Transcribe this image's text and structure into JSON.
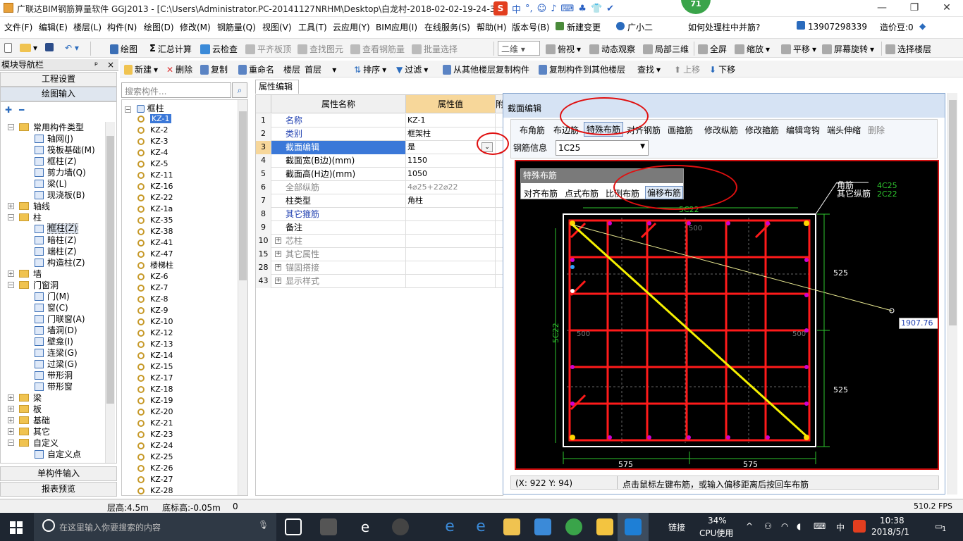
{
  "window": {
    "title": "广联达BIM钢筋算量软件 GGJ2013 - [C:\\Users\\Administrator.PC-20141127NRHM\\Desktop\\白龙村-2018-02-02-19-24-35",
    "ime_items": [
      "中",
      "°,",
      "☺",
      "♪",
      "⌨",
      "♣",
      "👕",
      "✔"
    ],
    "badge": "71",
    "controls": [
      "—",
      "❐",
      "✕"
    ]
  },
  "menu": {
    "items": [
      "文件(F)",
      "编辑(E)",
      "楼层(L)",
      "构件(N)",
      "绘图(D)",
      "修改(M)",
      "钢筋量(Q)",
      "视图(V)",
      "工具(T)",
      "云应用(Y)",
      "BIM应用(I)",
      "在线服务(S)",
      "帮助(H)",
      "版本号(B)",
      "新建变更",
      "广小二"
    ],
    "question": "如何处理柱中并筋?",
    "phone": "13907298339",
    "price_level": "造价豆:0"
  },
  "toolbar1": {
    "items": [
      "绘图",
      "汇总计算",
      "云检查",
      "平齐板顶",
      "查找图元",
      "查看钢筋量",
      "批量选择"
    ],
    "view_mode": "二维",
    "view_items": [
      "俯视",
      "动态观察",
      "局部三维",
      "全屏",
      "缩放",
      "平移",
      "屏幕旋转",
      "选择楼层"
    ]
  },
  "toolbar2": {
    "items": [
      "新建",
      "删除",
      "复制",
      "重命名",
      "楼层",
      "首层",
      "排序",
      "过滤",
      "从其他楼层复制构件",
      "复制构件到其他楼层",
      "查找",
      "上移",
      "下移"
    ]
  },
  "nav": {
    "header": "模块导航栏",
    "pin": "ᵖ",
    "close": "×",
    "buttons": [
      "工程设置",
      "绘图输入"
    ],
    "bottom_buttons": [
      "单构件输入",
      "报表预览"
    ],
    "tree": [
      {
        "label": "常用构件类型",
        "level": 0,
        "kind": "folder",
        "toggle": "−"
      },
      {
        "label": "轴网(J)",
        "level": 1,
        "kind": "item"
      },
      {
        "label": "筏板基础(M)",
        "level": 1,
        "kind": "item"
      },
      {
        "label": "框柱(Z)",
        "level": 1,
        "kind": "item"
      },
      {
        "label": "剪力墙(Q)",
        "level": 1,
        "kind": "item"
      },
      {
        "label": "梁(L)",
        "level": 1,
        "kind": "item"
      },
      {
        "label": "现浇板(B)",
        "level": 1,
        "kind": "item"
      },
      {
        "label": "轴线",
        "level": 0,
        "kind": "folder",
        "toggle": "+"
      },
      {
        "label": "柱",
        "level": 0,
        "kind": "folder",
        "toggle": "−"
      },
      {
        "label": "框柱(Z)",
        "level": 1,
        "kind": "item",
        "selected": true
      },
      {
        "label": "暗柱(Z)",
        "level": 1,
        "kind": "item"
      },
      {
        "label": "端柱(Z)",
        "level": 1,
        "kind": "item"
      },
      {
        "label": "构造柱(Z)",
        "level": 1,
        "kind": "item"
      },
      {
        "label": "墙",
        "level": 0,
        "kind": "folder",
        "toggle": "+"
      },
      {
        "label": "门窗洞",
        "level": 0,
        "kind": "folder",
        "toggle": "−"
      },
      {
        "label": "门(M)",
        "level": 1,
        "kind": "item"
      },
      {
        "label": "窗(C)",
        "level": 1,
        "kind": "item"
      },
      {
        "label": "门联窗(A)",
        "level": 1,
        "kind": "item"
      },
      {
        "label": "墙洞(D)",
        "level": 1,
        "kind": "item"
      },
      {
        "label": "壁龛(I)",
        "level": 1,
        "kind": "item"
      },
      {
        "label": "连梁(G)",
        "level": 1,
        "kind": "item"
      },
      {
        "label": "过梁(G)",
        "level": 1,
        "kind": "item"
      },
      {
        "label": "带形洞",
        "level": 1,
        "kind": "item"
      },
      {
        "label": "带形窗",
        "level": 1,
        "kind": "item"
      },
      {
        "label": "梁",
        "level": 0,
        "kind": "folder",
        "toggle": "+"
      },
      {
        "label": "板",
        "level": 0,
        "kind": "folder",
        "toggle": "+"
      },
      {
        "label": "基础",
        "level": 0,
        "kind": "folder",
        "toggle": "+"
      },
      {
        "label": "其它",
        "level": 0,
        "kind": "folder",
        "toggle": "+"
      },
      {
        "label": "自定义",
        "level": 0,
        "kind": "folder",
        "toggle": "−"
      },
      {
        "label": "自定义点",
        "level": 1,
        "kind": "item"
      }
    ]
  },
  "components": {
    "search_placeholder": "搜索构件...",
    "root": "框柱",
    "items": [
      "KZ-1",
      "KZ-2",
      "KZ-3",
      "KZ-4",
      "KZ-5",
      "KZ-11",
      "KZ-16",
      "KZ-22",
      "KZ-1a",
      "KZ-35",
      "KZ-38",
      "KZ-41",
      "KZ-47",
      "楼梯柱",
      "KZ-6",
      "KZ-7",
      "KZ-8",
      "KZ-9",
      "KZ-10",
      "KZ-12",
      "KZ-13",
      "KZ-14",
      "KZ-15",
      "KZ-17",
      "KZ-18",
      "KZ-19",
      "KZ-20",
      "KZ-21",
      "KZ-23",
      "KZ-24",
      "KZ-25",
      "KZ-26",
      "KZ-27",
      "KZ-28"
    ],
    "selected_index": 0
  },
  "properties": {
    "tab": "属性编辑",
    "col_name": "属性名称",
    "col_value": "属性值",
    "col_extra": "附",
    "rows": [
      {
        "no": "1",
        "name": "名称",
        "value": "KZ-1"
      },
      {
        "no": "2",
        "name": "类别",
        "value": "框架柱"
      },
      {
        "no": "3",
        "name": "截面编辑",
        "value": "是",
        "selected": true
      },
      {
        "no": "4",
        "name": "截面宽(B边)(mm)",
        "value": "1150",
        "black": true
      },
      {
        "no": "5",
        "name": "截面高(H边)(mm)",
        "value": "1050",
        "black": true
      },
      {
        "no": "6",
        "name": "全部纵筋",
        "value": "4⌀25+22⌀22",
        "gray": true
      },
      {
        "no": "7",
        "name": "柱类型",
        "value": "角柱",
        "black": true
      },
      {
        "no": "8",
        "name": "其它箍筋",
        "value": ""
      },
      {
        "no": "9",
        "name": "备注",
        "value": "",
        "black": true
      },
      {
        "no": "10",
        "name": "芯柱",
        "value": "",
        "group": true
      },
      {
        "no": "15",
        "name": "其它属性",
        "value": "",
        "group": true
      },
      {
        "no": "28",
        "name": "锚固搭接",
        "value": "",
        "group": true
      },
      {
        "no": "43",
        "name": "显示样式",
        "value": "",
        "group": true
      }
    ]
  },
  "section_editor": {
    "title": "截面编辑",
    "tools": [
      "布角筋",
      "布边筋",
      "特殊布筋",
      "对齐钢筋",
      "画箍筋",
      "修改纵筋",
      "修改箍筋",
      "编辑弯钩",
      "端头伸缩",
      "删除"
    ],
    "active_tool": "特殊布筋",
    "rebar_info_label": "钢筋信息",
    "rebar_value": "1C25",
    "popup_title": "特殊布筋",
    "popup_items": [
      "对齐布筋",
      "点式布筋",
      "比例布筋",
      "偏移布筋"
    ],
    "popup_active": "偏移布筋",
    "legend_labels": [
      "角筋",
      "其它纵筋"
    ],
    "legend_values": [
      "4C25",
      "2C22"
    ],
    "top_label": "5C22",
    "left_label": "5C22",
    "dim_right": [
      "525",
      "525"
    ],
    "dim_bottom": [
      "575",
      "575"
    ],
    "dim_mid": [
      "500",
      "500",
      "500"
    ],
    "input_value": "1907.76",
    "coords": "(X: 922 Y: 94)",
    "hint": "点击鼠标左键布筋，或输入偏移距离后按回车布筋"
  },
  "statusbar": {
    "floor_height": "层高:4.5m",
    "bottom_height": "底标高:-0.05m",
    "zero": "0",
    "fps": "510.2 FPS"
  },
  "taskbar": {
    "search_placeholder": "在这里输入你要搜索的内容",
    "link": "链接",
    "cpu_pct": "34%",
    "cpu_label": "CPU使用",
    "lang": "中",
    "time": "10:38",
    "date": "2018/5/1",
    "notif": "1"
  },
  "colors": {
    "accent": "#3b78d8",
    "canvas_bg": "#000000",
    "rebar_red": "#ff1a1a",
    "diag_yellow": "#f5f000",
    "annotation_red": "#e01010"
  }
}
